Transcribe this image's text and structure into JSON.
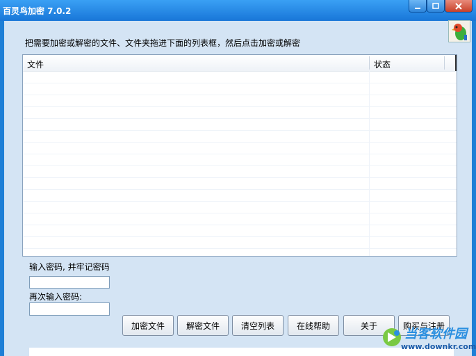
{
  "window": {
    "title": "百灵鸟加密 7.0.2"
  },
  "titlebar_buttons": {
    "minimize_icon": "minimize-icon",
    "maximize_icon": "maximize-icon",
    "close_icon": "close-icon"
  },
  "instruction": "把需要加密或解密的文件、文件夹拖进下面的列表框，然后点击加密或解密",
  "file_list": {
    "columns": [
      "文件",
      "状态"
    ],
    "rows": []
  },
  "password": {
    "label": "输入密码, 并牢记密码",
    "value": "",
    "confirm_label": "再次输入密码:",
    "confirm_value": ""
  },
  "buttons": {
    "encrypt": "加密文件",
    "decrypt": "解密文件",
    "clear": "清空列表",
    "help": "在线帮助",
    "about": "关于",
    "buy": "购买与注册"
  },
  "watermark": {
    "name": "当客软件园",
    "url": "www.downkr.com"
  },
  "colors": {
    "titlebar": "#1e7fd6",
    "client_bg": "#d4e4f4",
    "close": "#c7412a"
  }
}
